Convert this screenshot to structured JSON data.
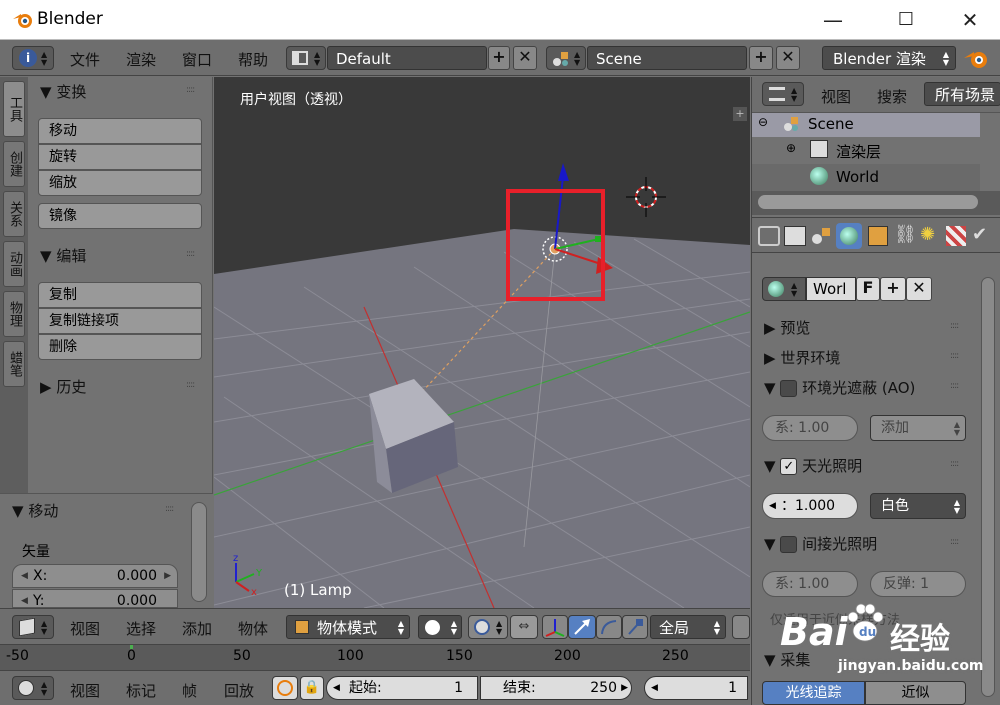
{
  "window": {
    "title": "Blender",
    "min": "—",
    "max": "☐",
    "close": "✕"
  },
  "menu": [
    "文件",
    "渲染",
    "窗口",
    "帮助"
  ],
  "layout_name": "Default",
  "scene_name": "Scene",
  "engine": "Blender 渲染",
  "left_tabs": [
    "工具",
    "创建",
    "关系",
    "动画",
    "物理",
    "蜡笔"
  ],
  "tools": {
    "transform_title": "变换",
    "transform_buttons": [
      "移动",
      "旋转",
      "缩放"
    ],
    "mirror": "镜像",
    "edit_title": "编辑",
    "edit_buttons": [
      "复制",
      "复制链接项",
      "删除"
    ],
    "history_title": "历史"
  },
  "operator": {
    "title": "移动",
    "vector_label": "矢量",
    "x_label": "X:",
    "x_value": "0.000",
    "y_label": "Y:",
    "y_value": "0.000"
  },
  "viewport": {
    "label": "用户视图（透视）",
    "object_info": "(1) Lamp"
  },
  "outliner": {
    "view": "视图",
    "search": "搜索",
    "filter": "所有场景",
    "items": [
      "Scene",
      "渲染层",
      "World"
    ]
  },
  "world_panel": {
    "world_name": "Worl",
    "fake_user": "F",
    "sections": {
      "preview": "预览",
      "world_env": "世界环境",
      "ao": "环境光遮蔽 (AO)",
      "env_light": "天光照明",
      "indirect": "间接光照明",
      "gather": "采集"
    },
    "ao_factor": "系: 1.00",
    "ao_blend": "添加",
    "env_energy": "：1.000",
    "env_color": "白色",
    "indirect_factor": "系: 1.00",
    "indirect_bounces": "反弹:  1",
    "note": "仅适用于近似采样方法",
    "gather_tabs": [
      "光线追踪",
      "近似"
    ]
  },
  "view3d_header": {
    "view": "视图",
    "select": "选择",
    "add": "添加",
    "object": "物体",
    "mode": "物体模式",
    "orientation": "全局"
  },
  "timeline": {
    "ticks": [
      "-50",
      "0",
      "50",
      "100",
      "150",
      "200",
      "250"
    ],
    "view": "视图",
    "marker": "标记",
    "frame": "帧",
    "playback": "回放",
    "start_label": "起始:",
    "start_value": "1",
    "end_label": "结束:",
    "end_value": "250",
    "current": "1"
  },
  "watermark": {
    "brand": "Bai",
    "brand_tail": "经验",
    "url": "jingyan.baidu.com"
  },
  "colors": {
    "accent_blue": "#5680c2",
    "highlight_red": "#e8202a",
    "bg": "#727272"
  }
}
